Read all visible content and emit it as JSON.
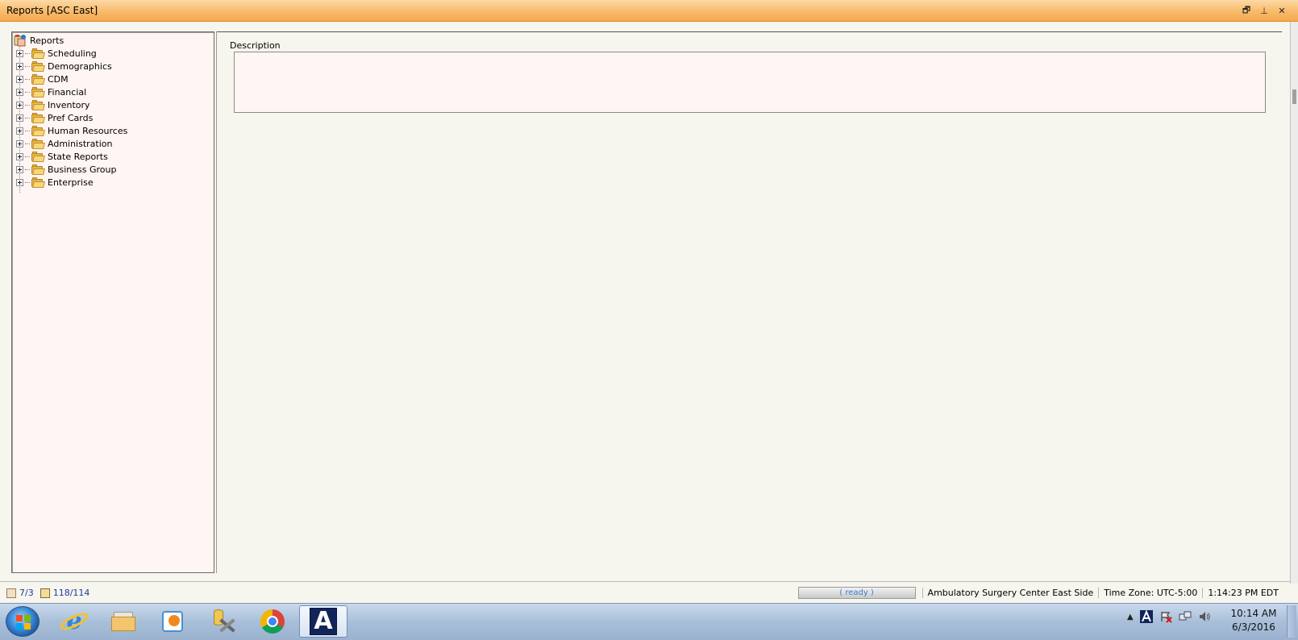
{
  "window": {
    "title": "Reports  [ASC East]",
    "controls": {
      "restore": "🗗",
      "pin": "⊥",
      "close": "✕"
    }
  },
  "tree": {
    "root_label": "Reports",
    "items": [
      {
        "label": "Scheduling"
      },
      {
        "label": "Demographics"
      },
      {
        "label": "CDM"
      },
      {
        "label": "Financial"
      },
      {
        "label": "Inventory"
      },
      {
        "label": "Pref Cards"
      },
      {
        "label": "Human Resources"
      },
      {
        "label": "Administration"
      },
      {
        "label": "State Reports"
      },
      {
        "label": "Business Group"
      },
      {
        "label": "Enterprise"
      }
    ]
  },
  "description": {
    "label": "Description",
    "value": ""
  },
  "status": {
    "messages_count": "7/3",
    "tasks_count": "118/114",
    "progress_text": "( ready )",
    "facility": "Ambulatory Surgery Center East Side",
    "timezone": "Time Zone: UTC-5:00",
    "server_time": "1:14:23 PM EDT"
  },
  "taskbar": {
    "apps": [
      {
        "name": "internet-explorer-icon"
      },
      {
        "name": "windows-explorer-icon"
      },
      {
        "name": "media-player-icon"
      },
      {
        "name": "database-tools-icon"
      },
      {
        "name": "chrome-icon"
      },
      {
        "name": "a-app-icon",
        "glyph": "A"
      }
    ],
    "tray_up": "▲",
    "clock_time": "10:14 AM",
    "clock_date": "6/3/2016"
  }
}
